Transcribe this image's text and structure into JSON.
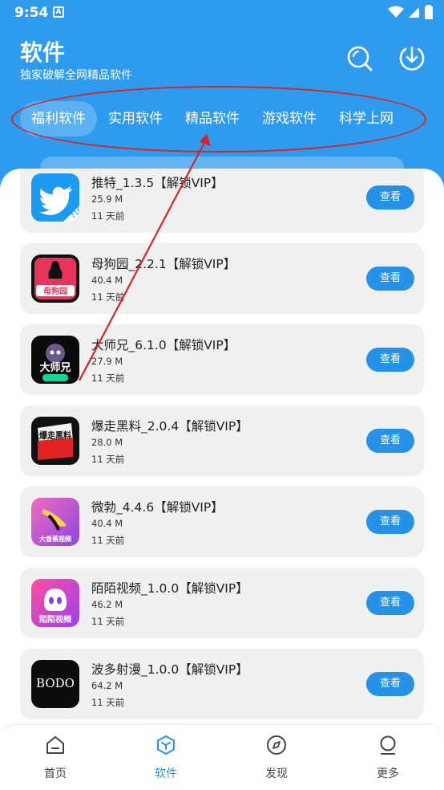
{
  "status_bar": {
    "time": "9:54",
    "notification_glyph": "A"
  },
  "header": {
    "title": "软件",
    "subtitle": "独家破解全网精品软件"
  },
  "tabs": [
    {
      "label": "福利软件",
      "active": true
    },
    {
      "label": "实用软件",
      "active": false
    },
    {
      "label": "精品软件",
      "active": false
    },
    {
      "label": "游戏软件",
      "active": false
    },
    {
      "label": "科学上网",
      "active": false
    }
  ],
  "apps": [
    {
      "name": "推特_1.3.5【解锁VIP】",
      "size": "25.9 M",
      "date": "11 天前",
      "button": "查看",
      "icon": "twitter-bird-icon",
      "icon_text": "718"
    },
    {
      "name": "母狗园_2.2.1【解锁VIP】",
      "size": "40.4 M",
      "date": "11 天前",
      "button": "查看",
      "icon": "mugouyuan-icon",
      "icon_text": "母狗园"
    },
    {
      "name": "大师兄_6.1.0【解锁VIP】",
      "size": "27.9 M",
      "date": "11 天前",
      "button": "查看",
      "icon": "dashixiong-icon",
      "icon_text": "大师兄"
    },
    {
      "name": "爆走黑料_2.0.4【解锁VIP】",
      "size": "28.0 M",
      "date": "11 天前",
      "button": "查看",
      "icon": "baozou-icon",
      "icon_text": "爆走黑料"
    },
    {
      "name": "微勃_4.4.6【解锁VIP】",
      "size": "40.4 M",
      "date": "11 天前",
      "button": "查看",
      "icon": "weibo-banana-icon",
      "icon_text": "大香蕉视频"
    },
    {
      "name": "陌陌视频_1.0.0【解锁VIP】",
      "size": "46.2 M",
      "date": "11 天前",
      "button": "查看",
      "icon": "momo-icon",
      "icon_text": "陌陌视频"
    },
    {
      "name": "波多射漫_1.0.0【解锁VIP】",
      "size": "64.2 M",
      "date": "11 天前",
      "button": "查看",
      "icon": "bodo-icon",
      "icon_text": "BODO"
    }
  ],
  "bottom_nav": [
    {
      "label": "首页",
      "icon": "home-icon",
      "active": false
    },
    {
      "label": "软件",
      "icon": "cube-icon",
      "active": true
    },
    {
      "label": "发现",
      "icon": "compass-icon",
      "active": false
    },
    {
      "label": "更多",
      "icon": "person-icon",
      "active": false
    }
  ],
  "colors": {
    "header_blue": "#2f9bef",
    "button_blue": "#2592e8",
    "annotation_red": "#d9232a",
    "card_bg": "#f0f0f0"
  }
}
